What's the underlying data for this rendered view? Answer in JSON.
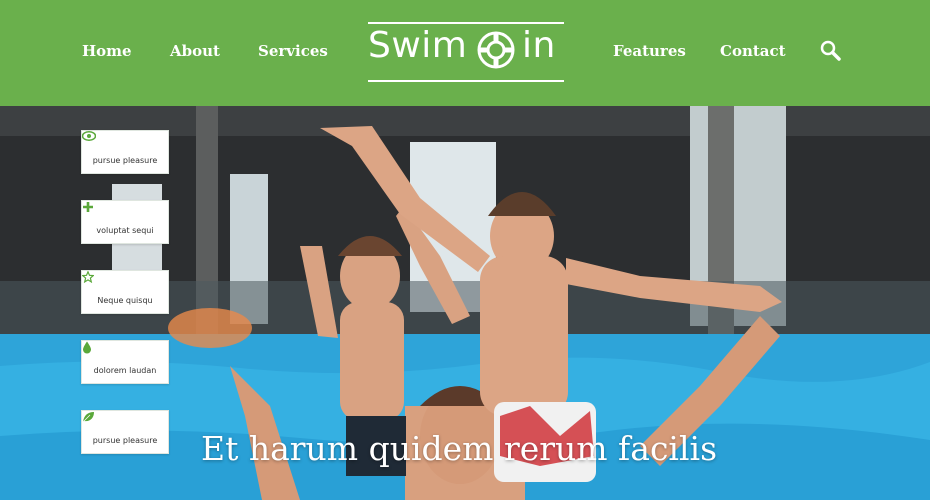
{
  "header": {
    "nav_left": [
      "Home",
      "About",
      "Services"
    ],
    "nav_right": [
      "Features",
      "Contact"
    ],
    "logo": {
      "part1": "Swim",
      "part2": "in"
    },
    "search_icon": "search-icon",
    "bg_color": "#6ab04c"
  },
  "side_menu": [
    {
      "icon": "eye-icon",
      "label": "pursue pleasure"
    },
    {
      "icon": "plus-icon",
      "label": "voluptat sequi"
    },
    {
      "icon": "star-icon",
      "label": "Neque quisqu"
    },
    {
      "icon": "drop-icon",
      "label": "dolorem laudan"
    },
    {
      "icon": "leaf-icon",
      "label": "pursue pleasure"
    }
  ],
  "hero": {
    "headline": "Et harum quidem rerum facilis"
  },
  "colors": {
    "accent": "#5aa83a",
    "pool": "#2da0d8"
  }
}
